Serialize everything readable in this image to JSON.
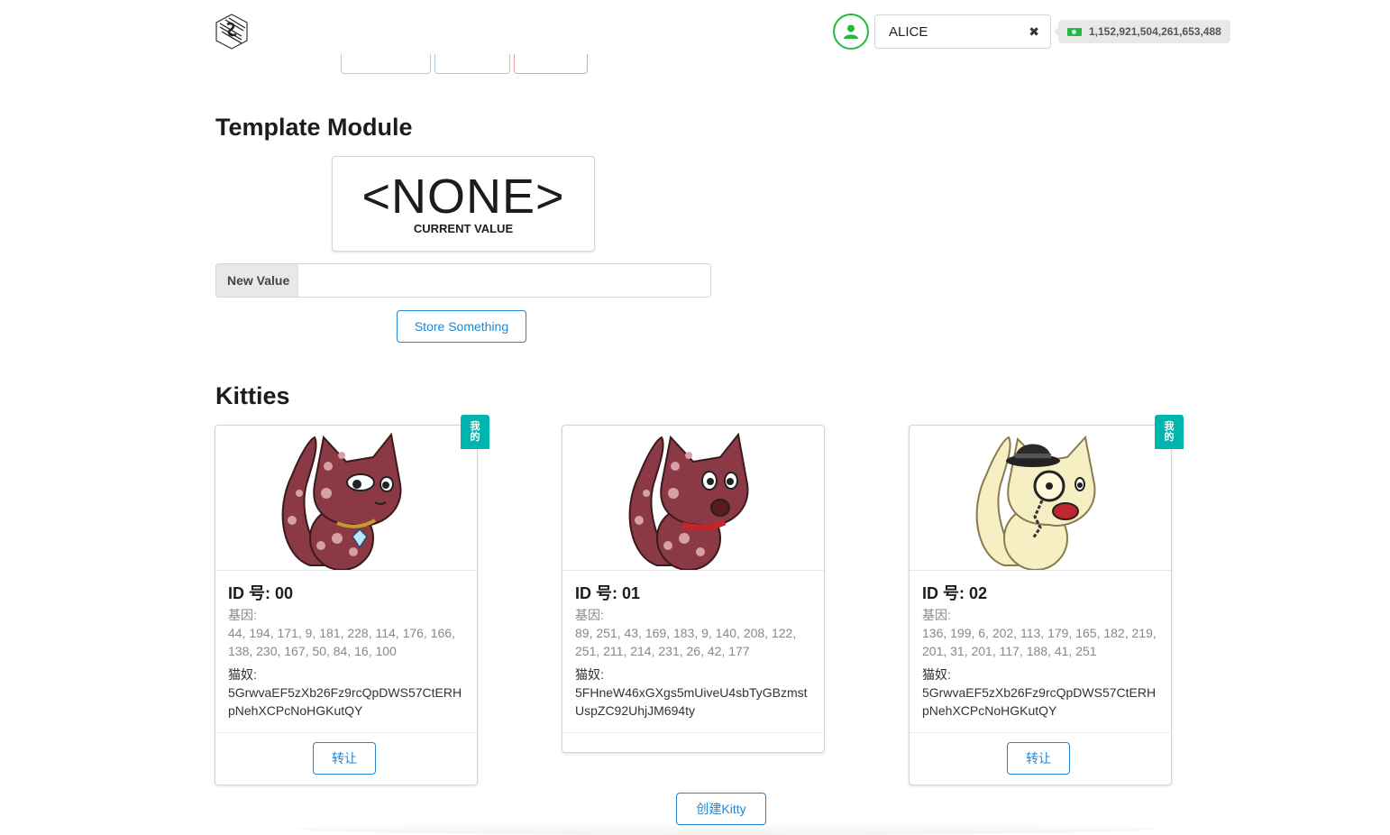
{
  "header": {
    "logo_icon": "substrate-logo-icon",
    "account": {
      "avatar_icon": "user-icon",
      "selected": "ALICE",
      "clear_icon": "close-icon",
      "balance": "1,152,921,504,261,653,488",
      "balance_icon": "cash-icon"
    }
  },
  "template_module": {
    "title": "Template Module",
    "current_value": "<NONE>",
    "current_value_label": "CURRENT VALUE",
    "input_label": "New Value",
    "input_value": "",
    "store_button": "Store Something"
  },
  "kitties": {
    "title": "Kitties",
    "cards": [
      {
        "id": "ID 号: 00",
        "dna_label": "基因:",
        "dna": "44, 194, 171, 9, 181, 228, 114, 176, 166, 138, 230, 167, 50, 84, 16, 100",
        "owner_label": "猫奴:",
        "owner": "5GrwvaEF5zXb26Fz9rcQpDWS57CtERHpNehXCPcNoHGKutQY",
        "mine_ribbon": "我的",
        "transfer_button": "转让"
      },
      {
        "id": "ID 号: 01",
        "dna_label": "基因:",
        "dna": "89, 251, 43, 169, 183, 9, 140, 208, 122, 251, 211, 214, 231, 26, 42, 177",
        "owner_label": "猫奴:",
        "owner": "5FHneW46xGXgs5mUiveU4sbTyGBzmstUspZC92UhjJM694ty"
      },
      {
        "id": "ID 号: 02",
        "dna_label": "基因:",
        "dna": "136, 199, 6, 202, 113, 179, 165, 182, 219, 201, 31, 201, 117, 188, 41, 251",
        "owner_label": "猫奴:",
        "owner": "5GrwvaEF5zXb26Fz9rcQpDWS57CtERHpNehXCPcNoHGKutQY",
        "mine_ribbon": "我的",
        "transfer_button": "转让"
      }
    ],
    "create_button": "创建Kitty"
  },
  "colors": {
    "primary": "#2185d0",
    "teal": "#00b5ad",
    "green": "#21ba45",
    "kitty_red": "#8b3a45",
    "kitty_cream": "#f7efc4"
  }
}
